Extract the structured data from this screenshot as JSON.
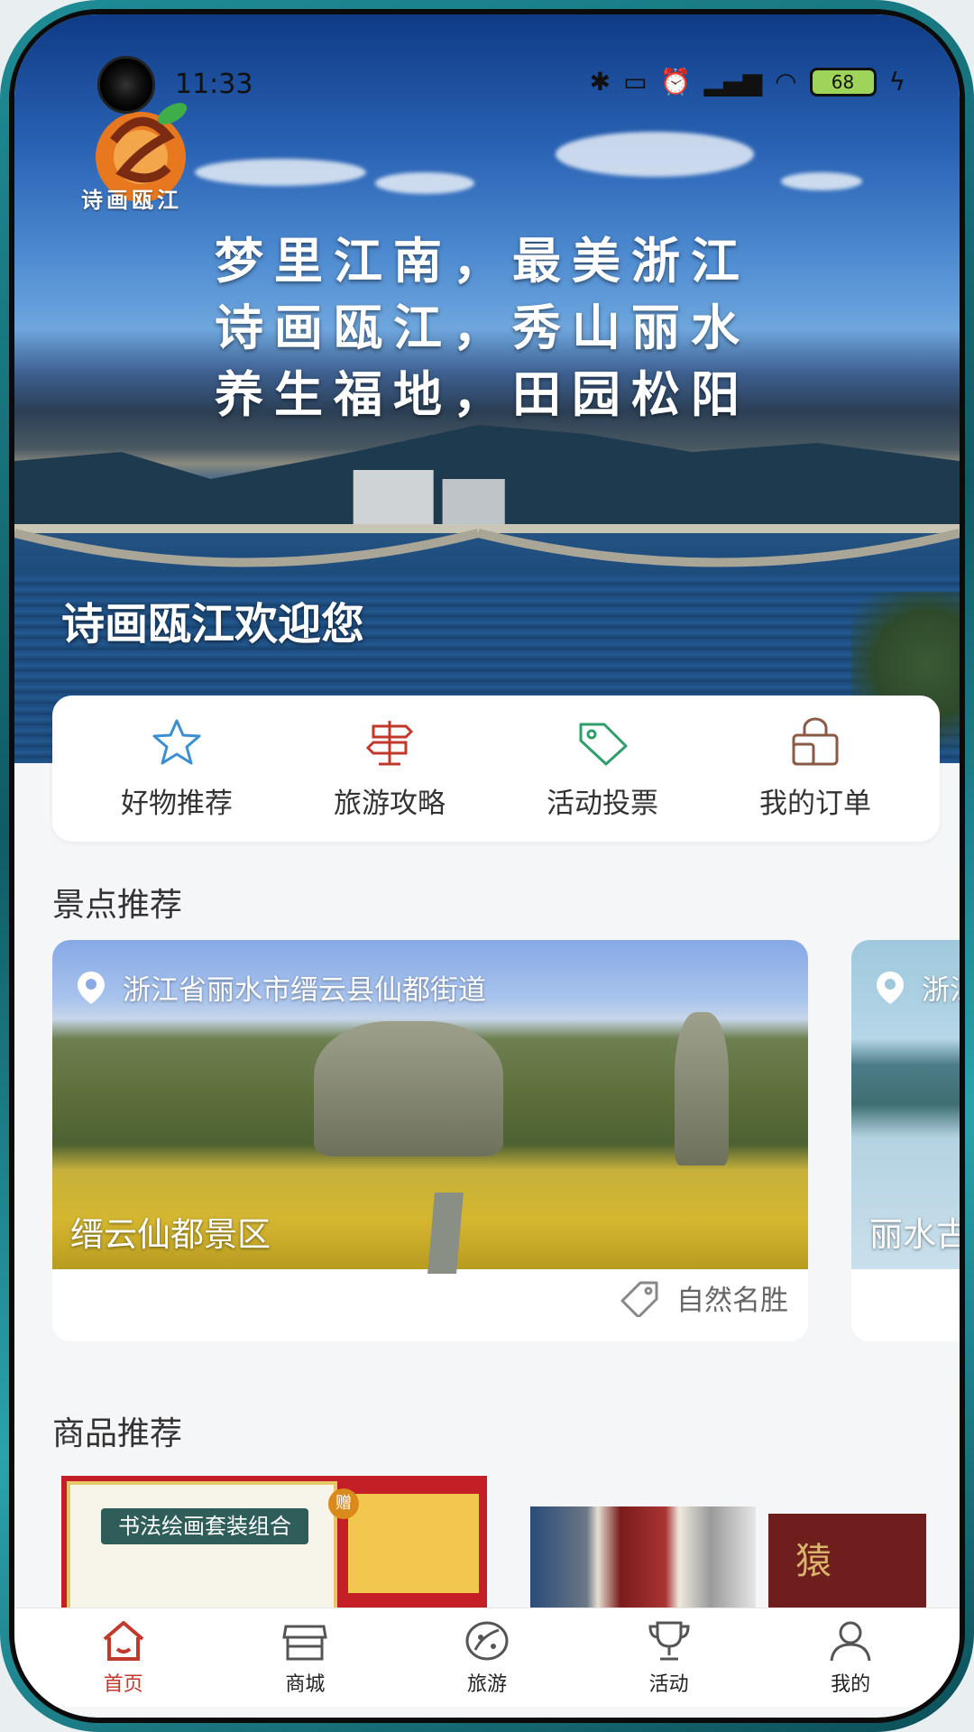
{
  "status_bar": {
    "time": "11:33",
    "battery": "68"
  },
  "hero": {
    "logo_caption": "诗画瓯江",
    "poem_lines": [
      "梦里江南，最美浙江",
      "诗画瓯江，秀山丽水",
      "养生福地，田园松阳"
    ],
    "welcome": "诗画瓯江欢迎您"
  },
  "quick_actions": [
    {
      "label": "好物推荐",
      "icon": "star-icon",
      "color": "#3b8fd1"
    },
    {
      "label": "旅游攻略",
      "icon": "signpost-icon",
      "color": "#c0392b"
    },
    {
      "label": "活动投票",
      "icon": "tag-icon",
      "color": "#2e9e6a"
    },
    {
      "label": "我的订单",
      "icon": "shopping-bag-icon",
      "color": "#8a5a44"
    }
  ],
  "sections": {
    "scenic_title": "景点推荐",
    "products_title": "商品推荐"
  },
  "scenic_spots": [
    {
      "location": "浙江省丽水市缙云县仙都街道",
      "name": "缙云仙都景区",
      "tag": "自然名胜"
    },
    {
      "location": "浙江",
      "name": "丽水古"
    }
  ],
  "products": [
    {
      "banner": "书法绘画套装组合",
      "gift_badge": "赠"
    },
    {},
    {
      "text": "猿"
    }
  ],
  "bottom_nav": [
    {
      "label": "首页",
      "icon": "home-icon",
      "active": true
    },
    {
      "label": "商城",
      "icon": "store-icon",
      "active": false
    },
    {
      "label": "旅游",
      "icon": "travel-icon",
      "active": false
    },
    {
      "label": "活动",
      "icon": "trophy-icon",
      "active": false
    },
    {
      "label": "我的",
      "icon": "user-icon",
      "active": false
    }
  ],
  "colors": {
    "accent": "#c0392b",
    "background": "#f5f6f8"
  }
}
